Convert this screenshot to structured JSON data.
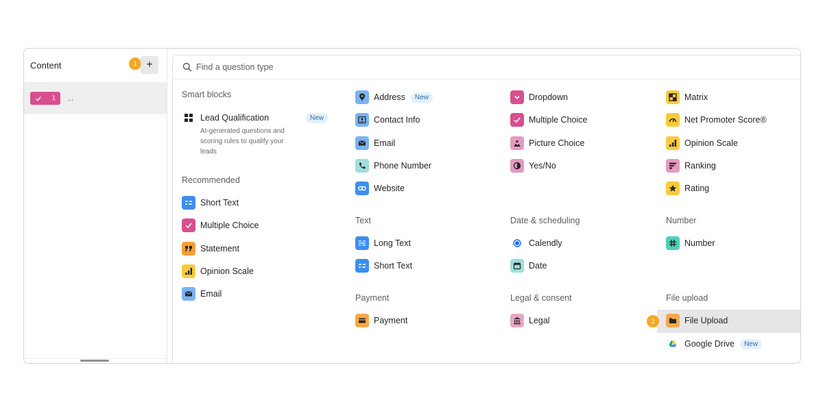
{
  "sidebar": {
    "title": "Content",
    "badge": "1",
    "add_label": "+",
    "item": {
      "number": "1",
      "dots": "...",
      "icon": "check-icon"
    }
  },
  "search": {
    "placeholder": "Find a question type",
    "icon": "search-icon"
  },
  "smart_blocks": {
    "title": "Smart blocks",
    "lead": {
      "label": "Lead Qualification",
      "badge": "New",
      "description": "AI-generated questions and scoring rules to qualify your leads",
      "icon": "grid-icon"
    }
  },
  "recommended": {
    "title": "Recommended",
    "items": [
      {
        "label": "Short Text",
        "icon": "short-text-icon",
        "color": "#3d8ef0"
      },
      {
        "label": "Multiple Choice",
        "icon": "check-icon",
        "color": "#d84f8f"
      },
      {
        "label": "Statement",
        "icon": "quote-icon",
        "color": "#f69d35"
      },
      {
        "label": "Opinion Scale",
        "icon": "bars-icon",
        "color": "#f8cb3c"
      },
      {
        "label": "Email",
        "icon": "email-icon",
        "color": "#7ab2f2"
      }
    ]
  },
  "contact": {
    "items": [
      {
        "label": "Address",
        "icon": "pin-icon",
        "color": "#7ab2f2",
        "badge": "New"
      },
      {
        "label": "Contact Info",
        "icon": "contact-icon",
        "color": "#7ab2f2"
      },
      {
        "label": "Email",
        "icon": "email-icon",
        "color": "#7ab2f2"
      },
      {
        "label": "Phone Number",
        "icon": "phone-icon",
        "color": "#9edfdb"
      },
      {
        "label": "Website",
        "icon": "link-icon",
        "color": "#3d8ef0"
      }
    ]
  },
  "choice": {
    "items": [
      {
        "label": "Dropdown",
        "icon": "chevron-down-icon",
        "color": "#d84f8f"
      },
      {
        "label": "Multiple Choice",
        "icon": "check-icon",
        "color": "#d84f8f"
      },
      {
        "label": "Picture Choice",
        "icon": "picture-icon",
        "color": "#e49ac1"
      },
      {
        "label": "Yes/No",
        "icon": "yes-no-icon",
        "color": "#e49ac1"
      }
    ]
  },
  "rating": {
    "items": [
      {
        "label": "Matrix",
        "icon": "matrix-icon",
        "color": "#f8cb3c"
      },
      {
        "label": "Net Promoter Score®",
        "icon": "gauge-icon",
        "color": "#f8cb3c"
      },
      {
        "label": "Opinion Scale",
        "icon": "bars-icon",
        "color": "#f8cb3c"
      },
      {
        "label": "Ranking",
        "icon": "ranking-icon",
        "color": "#e49ac1"
      },
      {
        "label": "Rating",
        "icon": "star-icon",
        "color": "#f8cb3c"
      }
    ]
  },
  "text": {
    "title": "Text",
    "items": [
      {
        "label": "Long Text",
        "icon": "long-text-icon",
        "color": "#3d8ef0"
      },
      {
        "label": "Short Text",
        "icon": "short-text-icon",
        "color": "#3d8ef0"
      }
    ]
  },
  "date_scheduling": {
    "title": "Date & scheduling",
    "items": [
      {
        "label": "Calendly",
        "icon": "calendly-icon",
        "color": "#1a6ef5"
      },
      {
        "label": "Date",
        "icon": "calendar-icon",
        "color": "#9edfdb"
      }
    ]
  },
  "number": {
    "title": "Number",
    "items": [
      {
        "label": "Number",
        "icon": "hash-icon",
        "color": "#4fd0b8"
      }
    ]
  },
  "payment": {
    "title": "Payment",
    "items": [
      {
        "label": "Payment",
        "icon": "card-icon",
        "color": "#f6a84a"
      }
    ]
  },
  "legal": {
    "title": "Legal & consent",
    "items": [
      {
        "label": "Legal",
        "icon": "bank-icon",
        "color": "#e9a6c7"
      }
    ]
  },
  "file_upload": {
    "title": "File upload",
    "badge": "2",
    "items": [
      {
        "label": "File Upload",
        "icon": "folder-icon",
        "color": "#f6a84a"
      },
      {
        "label": "Google Drive",
        "icon": "google-drive-icon",
        "badge": "New"
      }
    ]
  }
}
